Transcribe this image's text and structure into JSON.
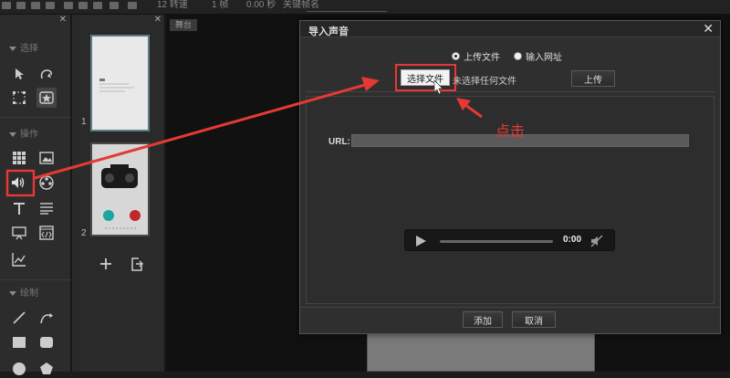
{
  "topbar": {
    "rotate": "12 转速",
    "frame": "1 帧",
    "time": "0.00 秒",
    "keyframe": "关键帧名"
  },
  "tools": {
    "section_select": "选择",
    "section_edit": "操作",
    "section_draw": "绘制",
    "icons": [
      "arrow-select-icon",
      "lasso-icon",
      "grid-select-icon",
      "box-select-icon",
      "grid-icon",
      "image-icon",
      "audio-icon",
      "video-reel-icon",
      "text-icon",
      "paragraph-icon",
      "screen-icon",
      "code-icon",
      "chart-icon",
      "line-icon",
      "curve-icon",
      "rect-icon",
      "rounded-rect-icon",
      "circle-icon",
      "pentagon-icon"
    ]
  },
  "thumbs": {
    "items": [
      {
        "num": "1"
      },
      {
        "num": "2"
      }
    ]
  },
  "stage": {
    "tab": "舞台"
  },
  "dialog": {
    "title": "导入声音",
    "radio_upload": "上传文件",
    "radio_url": "输入网址",
    "choose_file": "选择文件",
    "no_file": "未选择任何文件",
    "upload": "上传",
    "url_label": "URL:",
    "url_value": "",
    "time": "0:00",
    "add": "添加",
    "cancel": "取消"
  },
  "annotation": {
    "text": "点击",
    "color": "#e53935"
  }
}
